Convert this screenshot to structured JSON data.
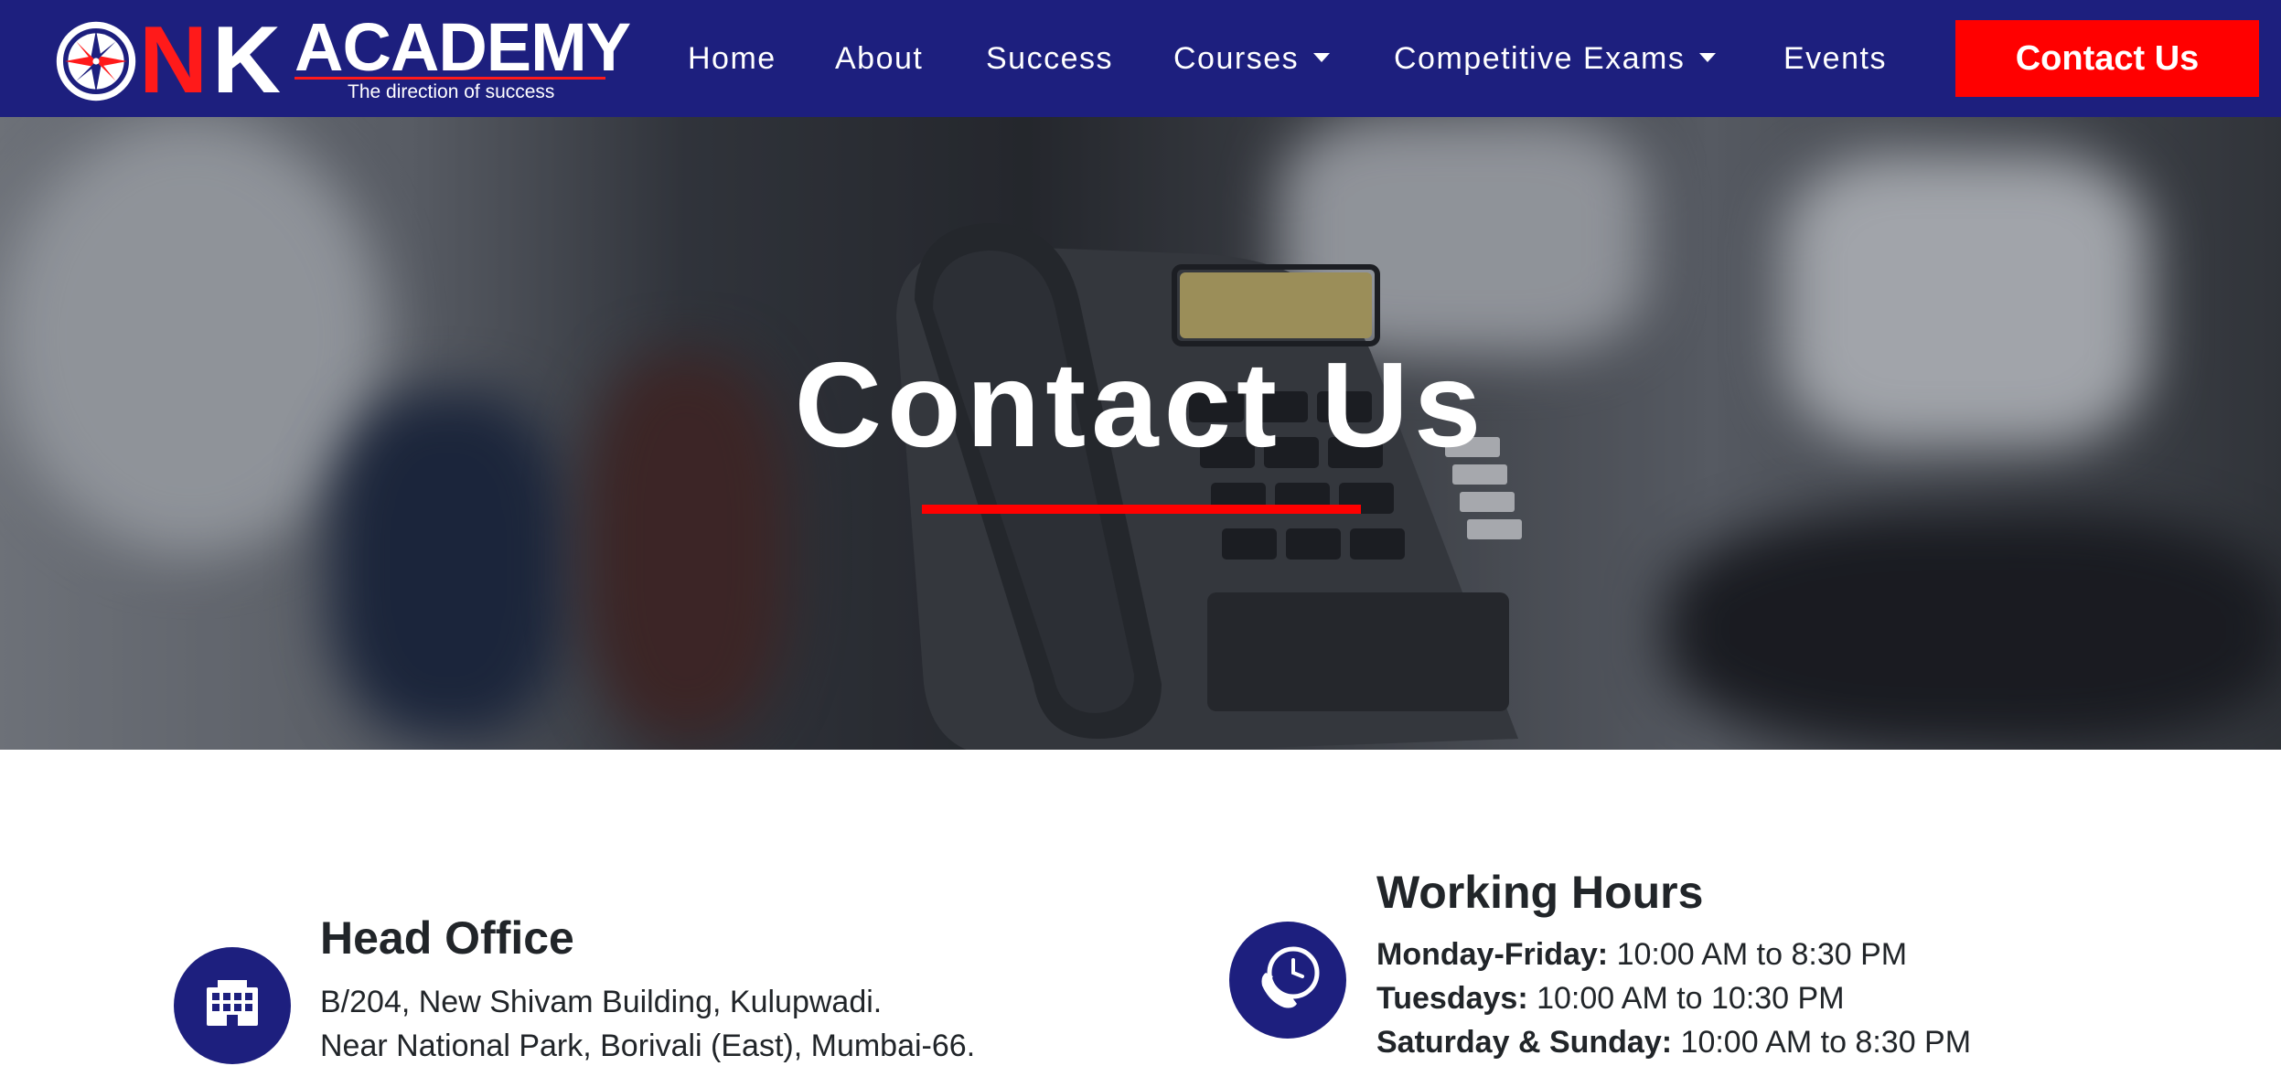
{
  "brand": {
    "letter_n": "N",
    "letter_k": "K",
    "name": "ACADEMY",
    "tagline": "The direction of success"
  },
  "nav": {
    "home": "Home",
    "about": "About",
    "success": "Success",
    "courses": "Courses",
    "competitive_exams": "Competitive Exams",
    "events": "Events",
    "contact_button": "Contact Us"
  },
  "hero": {
    "title": "Contact Us"
  },
  "head_office": {
    "title": "Head Office",
    "address_line1": "B/204, New Shivam Building, Kulupwadi.",
    "address_line2": "Near National Park, Borivali (East), Mumbai-66."
  },
  "working_hours": {
    "title": "Working Hours",
    "rows": [
      {
        "day": "Monday-Friday:",
        "time": "10:00 AM to 8:30 PM"
      },
      {
        "day": "Tuesdays:",
        "time": "10:00 AM to 10:30 PM"
      },
      {
        "day": "Saturday & Sunday:",
        "time": "10:00 AM to 8:30 PM"
      }
    ]
  },
  "colors": {
    "navy": "#1d1f7e",
    "red": "#ff0000",
    "text": "#212529"
  },
  "icons": {
    "logo": "compass-icon",
    "head_office": "building-icon",
    "working_hours": "phone-clock-icon"
  }
}
